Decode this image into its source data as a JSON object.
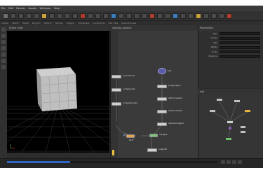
{
  "menubar": {
    "items": [
      "File",
      "Edit",
      "Render",
      "Assets",
      "Windows",
      "Help"
    ]
  },
  "shelf": {
    "tabs": [
      "Create",
      "Modify",
      "Model",
      "Polygon",
      "Deform",
      "Texture",
      "Rigging",
      "Characters",
      "Constraints",
      "Hair Utils",
      "Guide Process"
    ]
  },
  "viewport": {
    "header": "Scene View"
  },
  "network": {
    "header": "/obj/box_object1",
    "nodes": [
      {
        "id": "n1",
        "label": "transform1"
      },
      {
        "id": "n2",
        "label": "polybevel1"
      },
      {
        "id": "n3",
        "label": "polyextrude1"
      },
      {
        "id": "n4",
        "label": "box"
      },
      {
        "id": "n5",
        "label": "polybridge1"
      },
      {
        "id": "n6",
        "label": "attribcreate1"
      },
      {
        "id": "n7",
        "label": "attribcreate2"
      },
      {
        "id": "n8",
        "label": "attribwrangle1"
      },
      {
        "id": "n9",
        "label": "OUT"
      },
      {
        "id": "n10",
        "label": "merge1"
      },
      {
        "id": "n11",
        "label": "output0"
      }
    ]
  },
  "parameters": {
    "header": "Parameters",
    "rows": [
      "Type",
      "Center",
      "Size",
      "Rotate",
      "Scale",
      "Divisions"
    ]
  },
  "network2": {
    "header": "/obj"
  },
  "colors": {
    "accent": "#2f66c4",
    "node": "#d0d0d0",
    "highlight": "#f0c040"
  }
}
